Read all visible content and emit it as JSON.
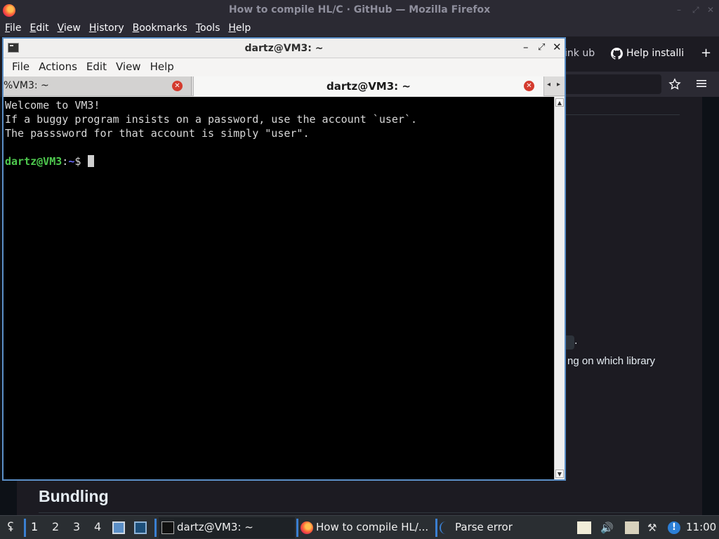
{
  "firefox": {
    "window_title": "How to compile HL/C · GitHub — Mozilla Firefox",
    "menu": [
      "File",
      "Edit",
      "View",
      "History",
      "Bookmarks",
      "Tools",
      "Help"
    ],
    "tab_partial_1": "ink ub",
    "tab_partial_2": "Help installi",
    "new_tab_label": "+",
    "content": {
      "inline_code_fragment": "e",
      "period": ".",
      "paragraph_fragment": "ng on which library",
      "heading": "Bundling"
    }
  },
  "terminal": {
    "window_title": "dartz@VM3: ~",
    "menu": [
      "File",
      "Actions",
      "Edit",
      "View",
      "Help"
    ],
    "tabs": [
      {
        "label": "%VM3: ~",
        "active": false
      },
      {
        "label": "dartz@VM3: ~",
        "active": true
      }
    ],
    "lines": [
      "Welcome to VM3!",
      "If a buggy program insists on a password, use the account `user`.",
      "The passsword for that account is simply \"user\"."
    ],
    "prompt": {
      "user_host": "dartz@VM3",
      "colon": ":",
      "path": "~",
      "symbol": "$"
    }
  },
  "taskbar": {
    "workspaces": [
      "1",
      "2",
      "3",
      "4"
    ],
    "tasks": [
      {
        "label": "dartz@VM3: ~",
        "icon": "terminal-icon"
      },
      {
        "label": "How to compile HL/...",
        "icon": "firefox-icon"
      },
      {
        "label": "Parse error",
        "icon": "app-icon"
      }
    ],
    "clock": "11:00"
  }
}
